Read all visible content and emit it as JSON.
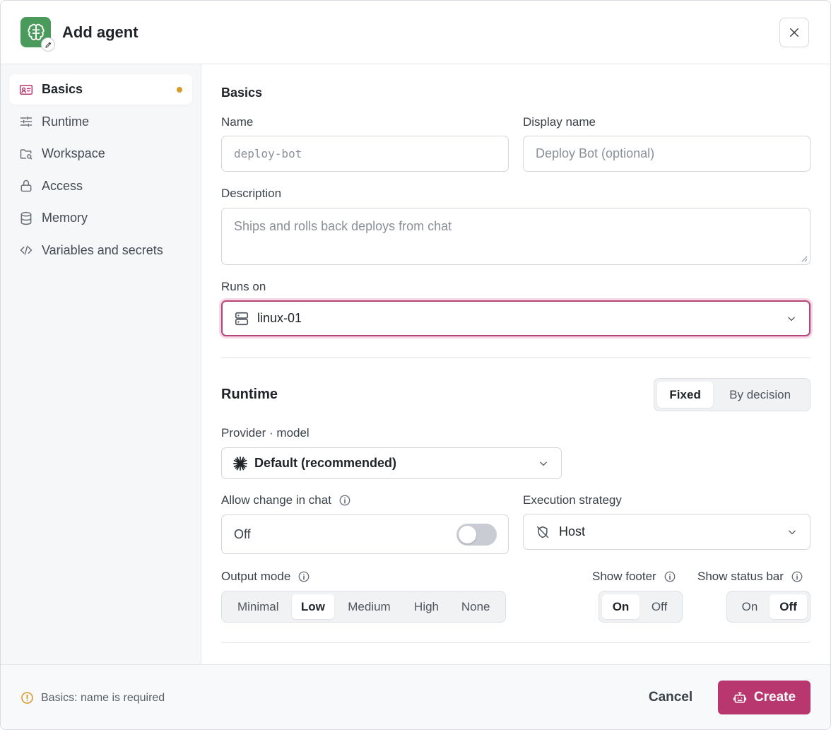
{
  "header": {
    "title": "Add agent",
    "logo_icon": "brain-icon",
    "badge_icon": "pencil-icon",
    "close_icon": "close-icon"
  },
  "sidebar": {
    "items": [
      {
        "label": "Basics",
        "icon": "id-card-icon",
        "active": true,
        "has_dot": true
      },
      {
        "label": "Runtime",
        "icon": "sliders-icon",
        "active": false
      },
      {
        "label": "Workspace",
        "icon": "folder-icon",
        "active": false
      },
      {
        "label": "Access",
        "icon": "lock-icon",
        "active": false
      },
      {
        "label": "Memory",
        "icon": "database-icon",
        "active": false
      },
      {
        "label": "Variables and secrets",
        "icon": "code-icon",
        "active": false
      }
    ]
  },
  "basics": {
    "title": "Basics",
    "name_label": "Name",
    "name_placeholder": "deploy-bot",
    "display_name_label": "Display name",
    "display_name_placeholder": "Deploy Bot (optional)",
    "description_label": "Description",
    "description_placeholder": "Ships and rolls back deploys from chat",
    "runs_on_label": "Runs on",
    "runs_on_value": "linux-01"
  },
  "runtime": {
    "title": "Runtime",
    "mode_options": [
      "Fixed",
      "By decision"
    ],
    "mode_selected": "Fixed",
    "provider_label": "Provider · model",
    "provider_value": "Default (recommended)",
    "allow_change_label": "Allow change in chat",
    "allow_change_value": "Off",
    "allow_change_on": false,
    "execution_label": "Execution strategy",
    "execution_value": "Host",
    "output_mode_label": "Output mode",
    "output_mode_options": [
      "Minimal",
      "Low",
      "Medium",
      "High",
      "None"
    ],
    "output_mode_selected": "Low",
    "show_footer_label": "Show footer",
    "show_footer_options": [
      "On",
      "Off"
    ],
    "show_footer_selected": "On",
    "show_status_label": "Show status bar",
    "show_status_options": [
      "On",
      "Off"
    ],
    "show_status_selected": "Off"
  },
  "footer": {
    "warning": "Basics: name is required",
    "cancel_label": "Cancel",
    "create_label": "Create"
  },
  "colors": {
    "accent": "#b8376f",
    "logo_bg": "#4a9a5c",
    "warning": "#d99a2b",
    "focus_ring": "#f7d7e5"
  }
}
